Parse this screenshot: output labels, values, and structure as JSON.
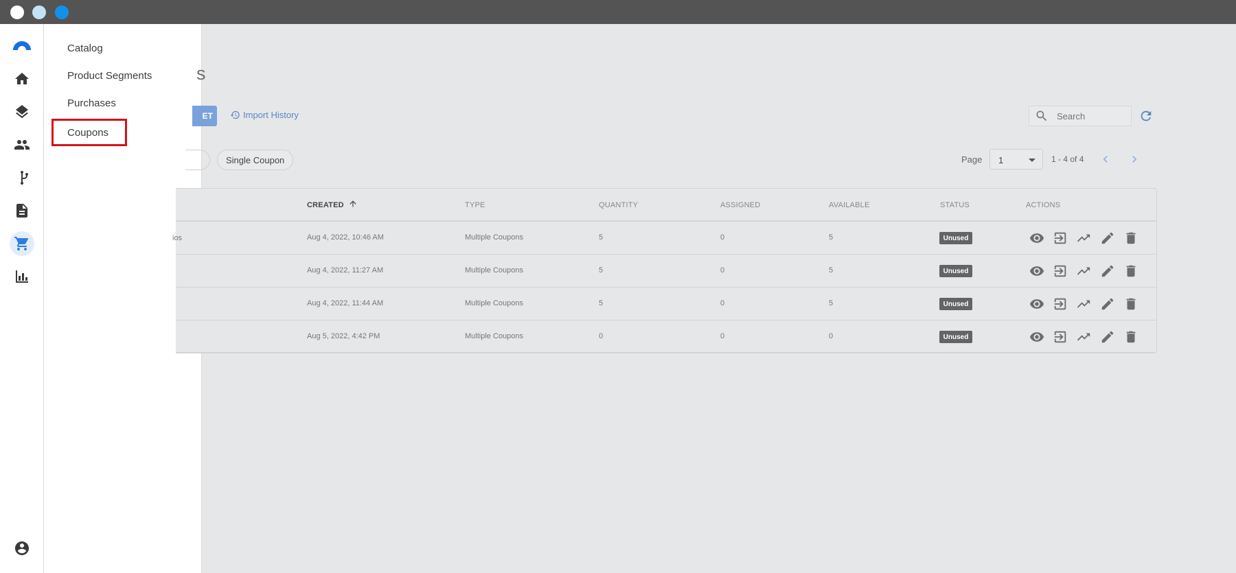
{
  "nav_menu": {
    "items": [
      "Catalog",
      "Product Segments",
      "Purchases",
      "Coupons"
    ],
    "selected": "Coupons"
  },
  "main": {
    "title_partial": "s",
    "button_partial": "ET",
    "import_link": "Import History",
    "search_placeholder": "Search",
    "filter_chip": "Single Coupon"
  },
  "pagination": {
    "label": "Page",
    "current": "1",
    "range": "1 - 4 of 4"
  },
  "table": {
    "headers": {
      "created": "CREATED",
      "type": "TYPE",
      "quantity": "QUANTITY",
      "assigned": "ASSIGNED",
      "available": "AVAILABLE",
      "status": "STATUS",
      "actions": "ACTIONS"
    },
    "rows": [
      {
        "name_partial": "ios",
        "created": "Aug 4, 2022, 10:46 AM",
        "type": "Multiple Coupons",
        "quantity": "5",
        "assigned": "0",
        "available": "5",
        "status": "Unused"
      },
      {
        "name_partial": "",
        "created": "Aug 4, 2022, 11:27 AM",
        "type": "Multiple Coupons",
        "quantity": "5",
        "assigned": "0",
        "available": "5",
        "status": "Unused"
      },
      {
        "name_partial": "",
        "created": "Aug 4, 2022, 11:44 AM",
        "type": "Multiple Coupons",
        "quantity": "5",
        "assigned": "0",
        "available": "5",
        "status": "Unused"
      },
      {
        "name_partial": "",
        "created": "Aug 5, 2022, 4:42 PM",
        "type": "Multiple Coupons",
        "quantity": "0",
        "assigned": "0",
        "available": "0",
        "status": "Unused"
      }
    ]
  },
  "colors": {
    "accent": "#2b7fe0",
    "highlight_border": "#d6111b",
    "status_badge": "#646464"
  },
  "icons": {
    "rail": [
      "logo",
      "home-icon",
      "layers-icon",
      "people-icon",
      "branch-icon",
      "document-icon",
      "cart-icon",
      "bar-chart-icon",
      "account-icon"
    ],
    "row_actions": [
      "eye-icon",
      "import-icon",
      "trending-up-icon",
      "edit-icon",
      "delete-icon"
    ]
  }
}
